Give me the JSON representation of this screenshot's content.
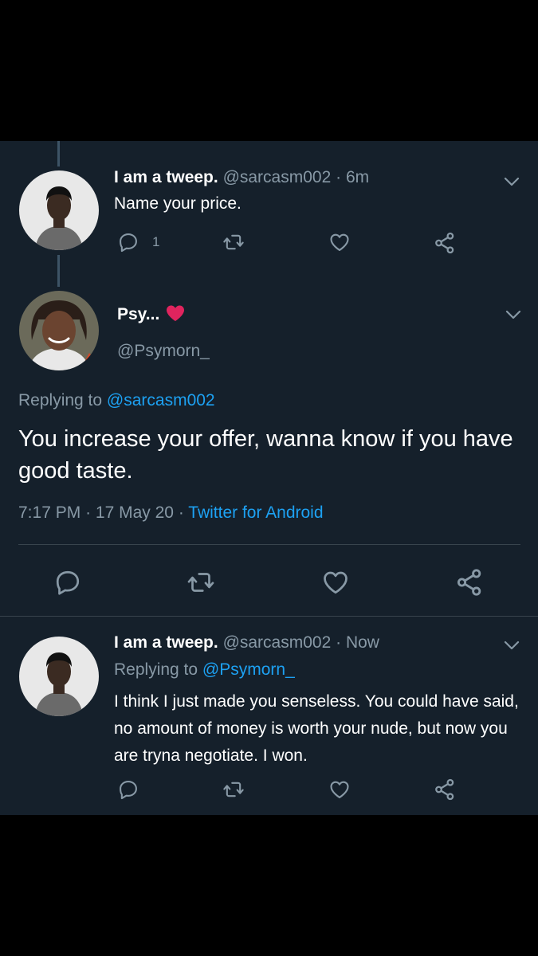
{
  "tweets": [
    {
      "display_name": "I am a tweep.",
      "handle": "@sarcasm002",
      "separator": "·",
      "time": "6m",
      "text": "Name your price.",
      "reply_count": "1"
    },
    {
      "display_name": "Psy...",
      "handle": "@Psymorn_",
      "replying_label": "Replying to",
      "replying_to": "@sarcasm002",
      "text": "You increase your offer, wanna know if you have good taste.",
      "time": "7:17 PM",
      "separator": "·",
      "date": "17 May 20",
      "source": "Twitter for Android"
    },
    {
      "display_name": "I am a tweep.",
      "handle": "@sarcasm002",
      "separator": "·",
      "time": "Now",
      "replying_label": "Replying to",
      "replying_to": "@Psymorn_",
      "text": "I think I just made you senseless. You could have said, no amount of money is worth your nude, but now you are tryna negotiate. I won."
    }
  ],
  "icons": {
    "reply": "reply-icon",
    "retweet": "retweet-icon",
    "like": "heart-icon",
    "share": "share-icon",
    "more": "chevron-down-icon",
    "emoji": "red-heart-emoji"
  },
  "colors": {
    "background": "#15202b",
    "text": "#ffffff",
    "muted": "#8899a6",
    "link": "#1da1f2",
    "heart_emoji": "#e0245e"
  }
}
